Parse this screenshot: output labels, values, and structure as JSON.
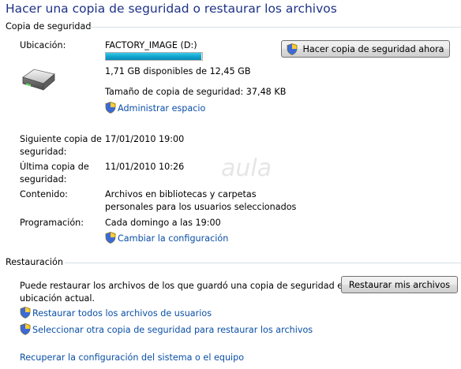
{
  "title": "Hacer una copia de seguridad o restaurar los archivos",
  "backup": {
    "section_label": "Copia de seguridad",
    "location_label": "Ubicación:",
    "location_value": "FACTORY_IMAGE (D:)",
    "space_used_fraction": 0.99,
    "space_text": "1,71 GB disponibles de 12,45 GB",
    "backup_size_text": "Tamaño de copia de seguridad: 37,48 KB",
    "manage_space_link": "Administrar espacio",
    "backup_now_button": "Hacer copia de seguridad ahora",
    "next_backup_label_1": "Siguiente copia de",
    "next_backup_label_2": "seguridad:",
    "next_backup_value": "17/01/2010 19:00",
    "last_backup_label_1": "Última copia de",
    "last_backup_label_2": "seguridad:",
    "last_backup_value": "11/01/2010 10:26",
    "contents_label": "Contenido:",
    "contents_value_1": "Archivos en bibliotecas y carpetas",
    "contents_value_2": "personales para los usuarios seleccionados",
    "schedule_label": "Programación:",
    "schedule_value": "Cada domingo a las 19:00",
    "change_settings_link": "Cambiar la configuración"
  },
  "restore": {
    "section_label": "Restauración",
    "description_1": "Puede restaurar los archivos de los que guardó una copia de seguridad en la",
    "description_2": "ubicación actual.",
    "restore_my_files_button": "Restaurar mis archivos",
    "restore_all_users_link": "Restaurar todos los archivos de usuarios",
    "select_other_backup_link": "Seleccionar otra copia de seguridad para restaurar los archivos",
    "recover_system_link": "Recuperar la configuración del sistema o el equipo"
  },
  "watermark": "aula"
}
